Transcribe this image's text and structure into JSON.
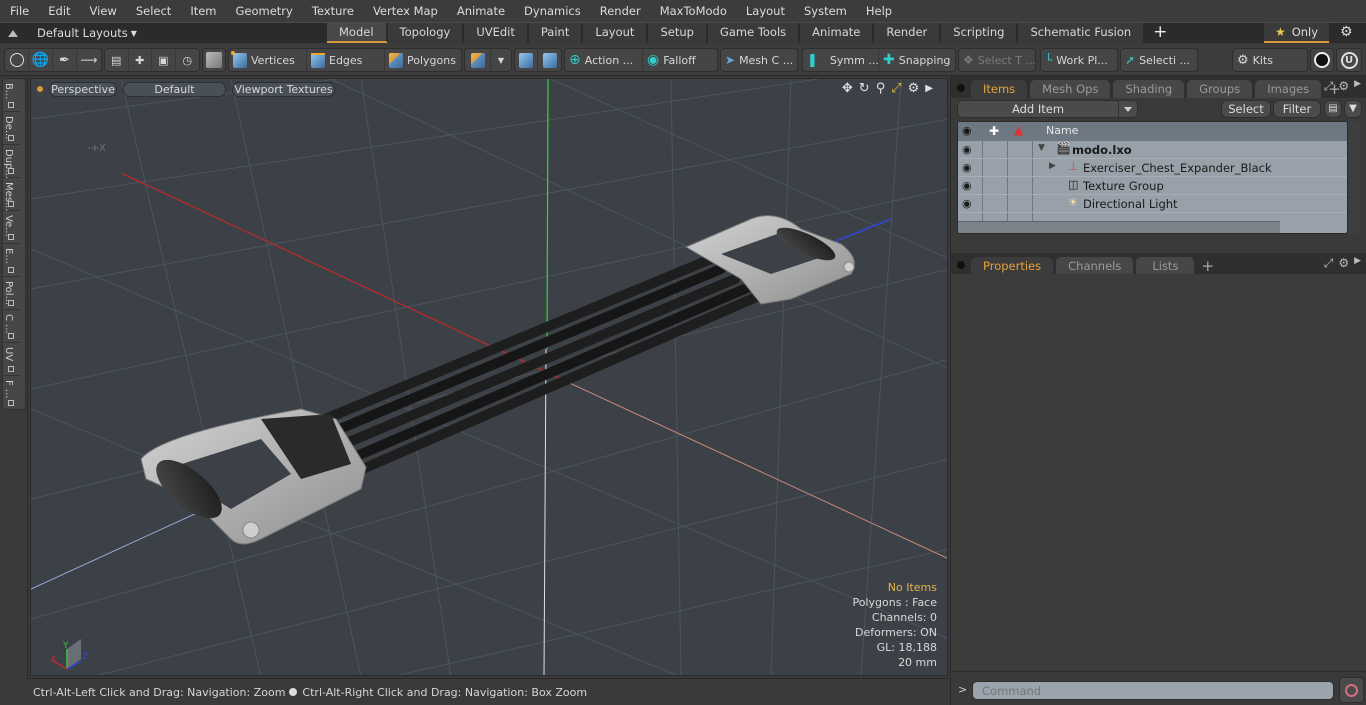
{
  "menu": [
    "File",
    "Edit",
    "View",
    "Select",
    "Item",
    "Geometry",
    "Texture",
    "Vertex Map",
    "Animate",
    "Dynamics",
    "Render",
    "MaxToModo",
    "Layout",
    "System",
    "Help"
  ],
  "layout_bar": {
    "layout_dropdown": "Default Layouts",
    "tabs": [
      "Model",
      "Topology",
      "UVEdit",
      "Paint",
      "Layout",
      "Setup",
      "Game Tools",
      "Animate",
      "Render",
      "Scripting",
      "Schematic Fusion"
    ],
    "active_tab": "Model",
    "only_label": "Only"
  },
  "toolbar": {
    "vertices": "Vertices",
    "edges": "Edges",
    "polygons": "Polygons",
    "action": "Action ...",
    "falloff": "Falloff",
    "mesh_c": "Mesh C ...",
    "symm": "Symm ...",
    "snapping": "Snapping",
    "select_t": "Select T ...",
    "work_pl": "Work Pl...",
    "selecti": "Selecti ...",
    "kits": "Kits"
  },
  "left_tabs": [
    "B...",
    "De...",
    "Dup...",
    "Mes...",
    "Ve...",
    "E...",
    "Pol...",
    "C ...",
    "UV",
    "F ..."
  ],
  "viewport": {
    "view_mode": "Perspective",
    "shading": "Default",
    "textures": "Viewport Textures",
    "info": {
      "selection": "No Items",
      "polygons": "Polygons : Face",
      "channels": "Channels: 0",
      "deformers": "Deformers: ON",
      "gl": "GL: 18,188",
      "scale": "20 mm"
    },
    "axes": {
      "x": "X",
      "y": "Y",
      "z": "Z"
    }
  },
  "status": {
    "left": "Ctrl-Alt-Left Click and Drag: Navigation: Zoom",
    "right": "Ctrl-Alt-Right Click and Drag: Navigation: Box Zoom"
  },
  "items_panel": {
    "tabs": [
      "Items",
      "Mesh Ops",
      "Shading",
      "Groups",
      "Images"
    ],
    "active_tab": "Items",
    "add_item": "Add Item",
    "select": "Select",
    "filter": "Filter",
    "column_name": "Name",
    "items": [
      {
        "name": "modo.lxo",
        "icon": "scene-clapper-icon",
        "bold": true
      },
      {
        "name": "Exerciser_Chest_Expander_Black",
        "icon": "mesh-locator-icon"
      },
      {
        "name": "Texture Group",
        "icon": "texture-group-icon"
      },
      {
        "name": "Directional Light",
        "icon": "directional-light-icon"
      }
    ]
  },
  "properties_panel": {
    "tabs": [
      "Properties",
      "Channels",
      "Lists"
    ],
    "active_tab": "Properties"
  },
  "command": {
    "prompt": ">",
    "placeholder": "Command"
  }
}
